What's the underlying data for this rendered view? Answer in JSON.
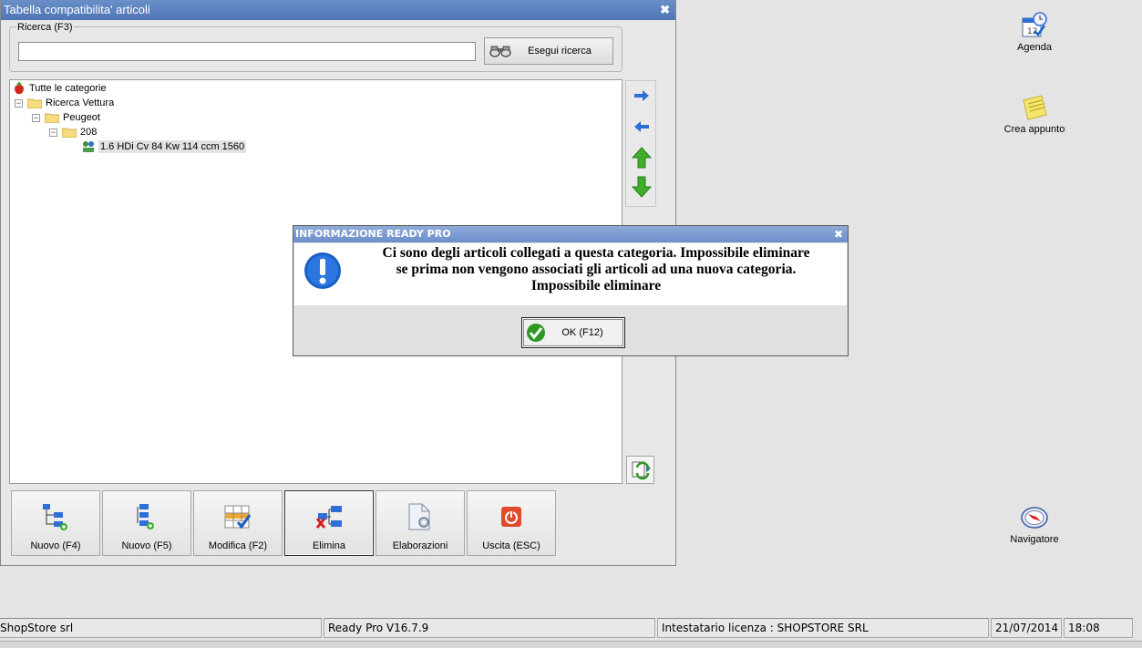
{
  "window": {
    "title": "Tabella compatibilita' articoli",
    "close_glyph": "✖"
  },
  "search": {
    "legend": "Ricerca (F3)",
    "value": "",
    "placeholder": "",
    "button_label": "Esegui ricerca",
    "button_icon": "binoculars-icon"
  },
  "tree": {
    "root": "Tutte le categorie",
    "nodes": [
      {
        "label": "Ricerca Vettura",
        "level": 1
      },
      {
        "label": "Peugeot",
        "level": 2
      },
      {
        "label": "208",
        "level": 3
      },
      {
        "label": "1.6 HDi Cv 84 Kw 114 ccm 1560",
        "level": 4
      }
    ],
    "expander": "−"
  },
  "side_tools": [
    "arrow-right-icon",
    "arrow-left-icon",
    "arrow-up-icon",
    "arrow-down-icon"
  ],
  "bottom_buttons": [
    {
      "label": "Nuovo (F4)",
      "icon": "new-node-icon"
    },
    {
      "label": "Nuovo (F5)",
      "icon": "new-child-node-icon"
    },
    {
      "label": "Modifica (F2)",
      "icon": "edit-grid-icon"
    },
    {
      "label": "Elimina",
      "icon": "delete-node-icon"
    },
    {
      "label": "Elaborazioni",
      "icon": "processing-icon"
    },
    {
      "label": "Uscita (ESC)",
      "icon": "exit-icon"
    }
  ],
  "dialog": {
    "title": "INFORMAZIONE READY PRO",
    "close_glyph": "✖",
    "message_lines": [
      "Ci sono degli articoli collegati a questa categoria. Impossibile eliminare",
      "se prima non vengono associati gli articoli ad una nuova categoria.",
      "Impossibile eliminare"
    ],
    "ok_label": "OK (F12)"
  },
  "desktop_icons": [
    {
      "label": "Agenda",
      "icon": "calendar-clock-icon"
    },
    {
      "label": "Crea appunto",
      "icon": "sticky-note-icon"
    },
    {
      "label": "Navigatore",
      "icon": "compass-icon"
    }
  ],
  "status_bar": {
    "company": "ShopStore srl",
    "version": "Ready Pro V16.7.9",
    "license": "Intestatario licenza : SHOPSTORE SRL",
    "date": "21/07/2014",
    "time": "18:08"
  },
  "colors": {
    "title_bar": "#5a80bf",
    "dialog_title_bar": "#7e9dd2",
    "info_icon_blue": "#1a5fc8",
    "ok_green": "#2f9a22"
  }
}
